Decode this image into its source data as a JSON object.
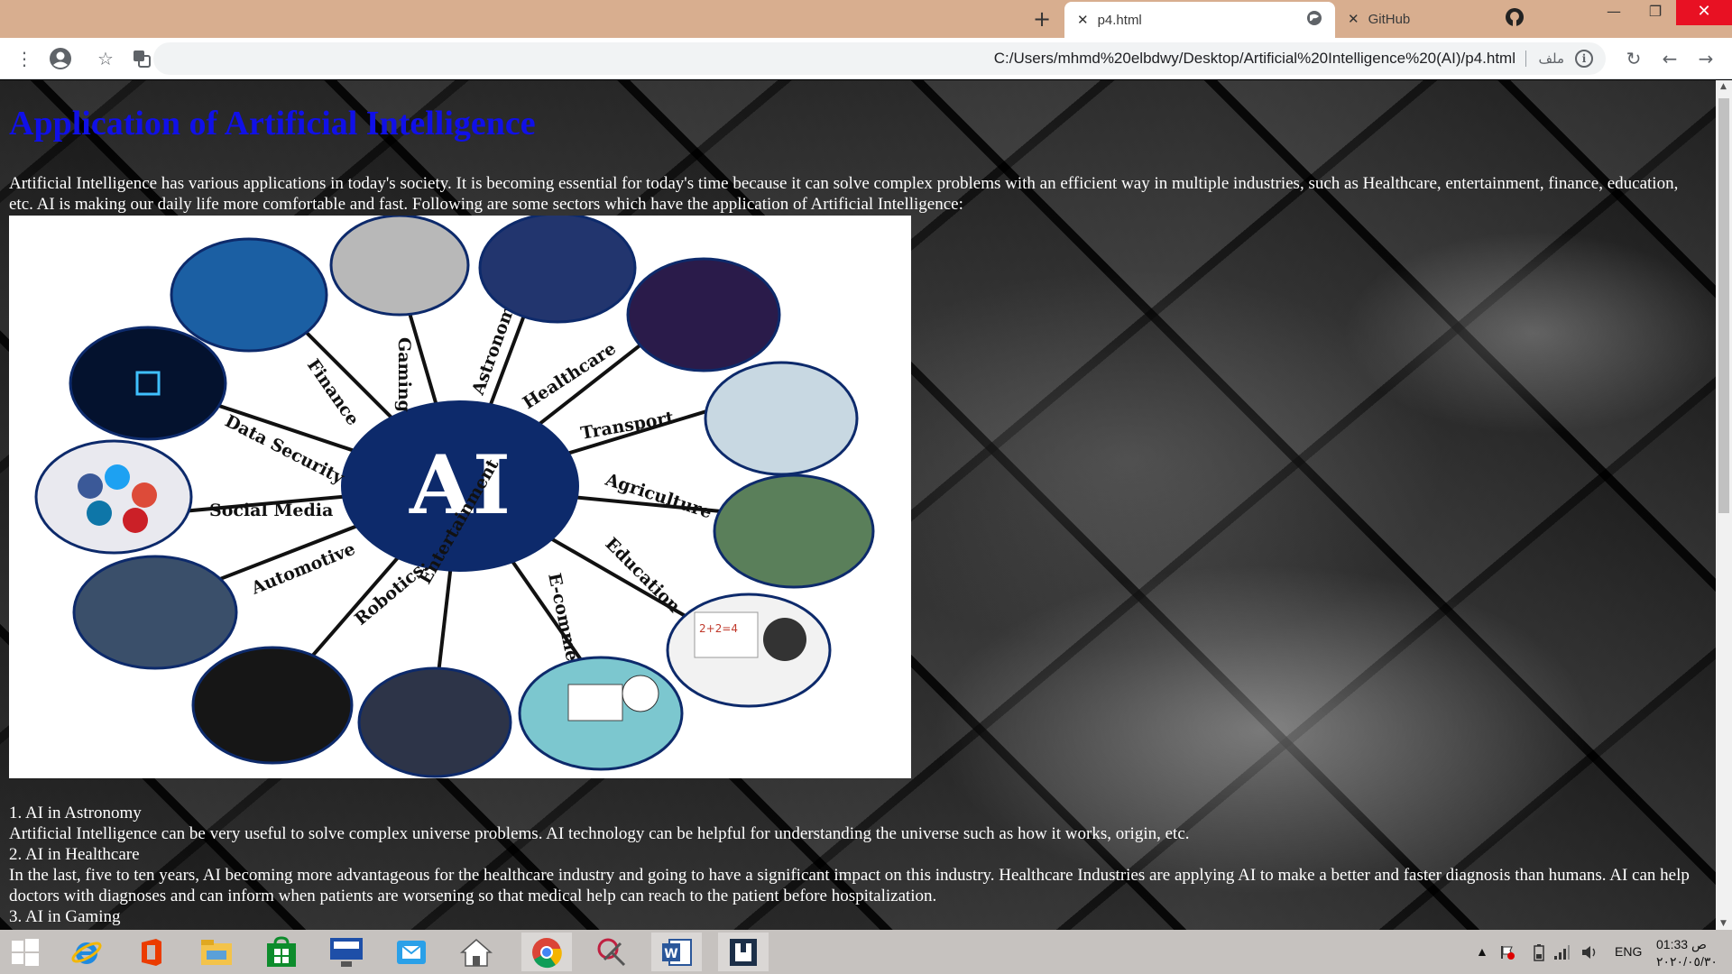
{
  "browser": {
    "tabs": [
      {
        "title": "p4.html",
        "active": true
      },
      {
        "title": "GitHub",
        "active": false
      }
    ],
    "address": {
      "url": "C:/Users/mhmd%20elbdwy/Desktop/Artificial%20Intelligence%20(AI)/p4.html",
      "site_label": "ملف"
    }
  },
  "page": {
    "title": "Application of Artificial Intelligence",
    "intro": "Artificial Intelligence has various applications in today's society. It is becoming essential for today's time because it can solve complex problems with an efficient way in multiple industries, such as Healthcare, entertainment, finance, education, etc. AI is making our daily life more comfortable and fast. Following are some sectors which have the application of Artificial Intelligence:",
    "figure": {
      "center_label": "AI",
      "spokes": [
        "Finance",
        "Gaming",
        "Astronomy",
        "Healthcare",
        "Transport",
        "Agriculture",
        "Education",
        "E-commerce",
        "Entertainment",
        "Robotics:",
        "Automotive",
        "Social Media",
        "Data Security"
      ],
      "slate_text": "2+2=4"
    },
    "sections": [
      {
        "heading": "1. AI in Astronomy",
        "text": "Artificial Intelligence can be very useful to solve complex universe problems. AI technology can be helpful for understanding the universe such as how it works, origin, etc."
      },
      {
        "heading": "2. AI in Healthcare",
        "text": "In the last, five to ten years, AI becoming more advantageous for the healthcare industry and going to have a significant impact on this industry. Healthcare Industries are applying AI to make a better and faster diagnosis than humans. AI can help doctors with diagnoses and can inform when patients are worsening so that medical help can reach to the patient before hospitalization."
      },
      {
        "heading": "3. AI in Gaming",
        "text": ""
      }
    ],
    "colors": {
      "title": "#1010e8",
      "ai_circle": "#0d2a6b",
      "text": "#ffffff"
    }
  },
  "taskbar": {
    "apps": [
      "windows-start",
      "internet-explorer",
      "office",
      "file-explorer",
      "store",
      "lenovo",
      "mail",
      "home",
      "chrome",
      "snipping-tool",
      "word",
      "app-frame"
    ],
    "tray": {
      "language": "ENG",
      "time": "01:33 ص",
      "date": "٢٠٢٠/٠٥/٣٠"
    }
  }
}
